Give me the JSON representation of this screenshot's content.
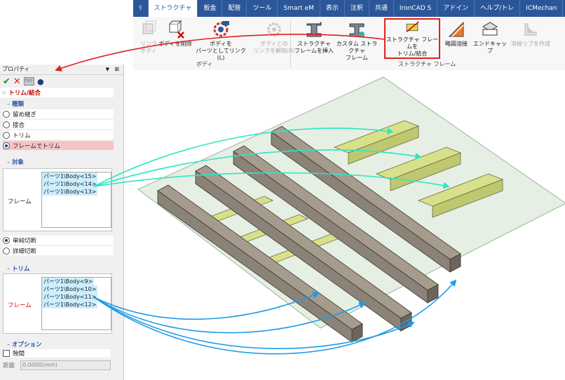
{
  "ribbon": {
    "tabs": [
      "ﾘ",
      "ストラクチャ",
      "板金",
      "配管",
      "ツール",
      "Smart eM",
      "表示",
      "注釈",
      "共通",
      "IronCAD S",
      "アドイン",
      "ヘルプ/トレ",
      "ICMechan"
    ],
    "active_tab": "ストラクチャ",
    "buttons": {
      "link_body": "リンク\nボディ",
      "delete_body": "ボディを削除",
      "link_as_part": "ボディを\nパーツとしてリンク(L)",
      "unlink_body": "ボディとの\nリンクを解除(B)",
      "insert_frame": "ストラクチャ\nフレームを挿入",
      "custom_frame": "カスタム ストラクチャ\nフレーム",
      "trim_join": "ストラクチャ フレームを\nトリム/結合",
      "weld": "略図溶接",
      "end_cap": "エンドキャップ",
      "rib": "溶接リブを作成"
    },
    "groups": {
      "body": "ボディ",
      "frame": "ストラクチャ フレーム"
    }
  },
  "panel": {
    "title": "プロパティ",
    "header": "トリム/結合",
    "type_section": "種類",
    "types": [
      "留め継ぎ",
      "接合",
      "トリム",
      "フレームでトリム"
    ],
    "selected_type": 3,
    "target_section": "対象",
    "frame_label": "フレーム",
    "target_items": [
      "パーツ1\\Body<15>",
      "パーツ1\\Body<14>",
      "パーツ1\\Body<13>"
    ],
    "cut_options": [
      "単純切断",
      "詳細切断"
    ],
    "selected_cut": 0,
    "trim_section": "トリム",
    "trim_frame_label": "フレーム",
    "trim_items": [
      "パーツ1\\Body<9>",
      "パーツ1\\Body<10>",
      "パーツ1\\Body<11>",
      "パーツ1\\Body<12>"
    ],
    "option_section": "オプション",
    "gap_label": "隙間",
    "distance_label": "距離",
    "distance_value": "0.0000(mm)"
  },
  "colors": {
    "ribbon": "#2b579a",
    "highlight": "#e02020",
    "teal_arrow": "#2ee6c2",
    "blue_arrow": "#1e9be8",
    "frame_yellow": "#d8e08c",
    "frame_gray": "#8c8378"
  }
}
